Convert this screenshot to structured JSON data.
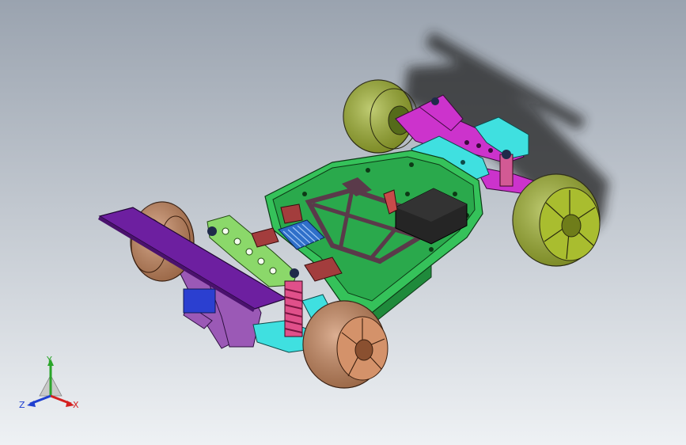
{
  "viewport": {
    "background_top": "#9aa3af",
    "background_bottom": "#eef1f4"
  },
  "model": {
    "parts": {
      "chassis_color": "#35c25a",
      "front_wheel_color": "#c98458",
      "rear_wheel_color": "#9fb229",
      "front_wing_color": "#6d1fa0",
      "front_bracket_color": "#9b59b6",
      "shock_tower_color": "#8bd86a",
      "rear_arm_color": "#cc33cc",
      "rear_mount_color": "#3fe0e0",
      "spring_color": "#e0508a",
      "heatsink_color": "#2f6fc9",
      "battery_color": "#252525",
      "brace_color": "#5a3a4a",
      "block_color": "#a33d3d",
      "shadow_color": "#222222"
    }
  },
  "triad": {
    "y_label": "Y",
    "x_label": "X",
    "z_label": "Z",
    "y_color": "#2aa52a",
    "x_color": "#d42020",
    "z_color": "#2040d0"
  }
}
